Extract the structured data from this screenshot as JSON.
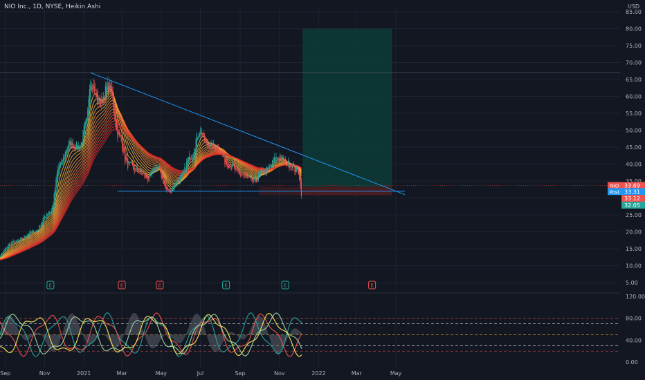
{
  "header": {
    "symbol_title": "NIO Inc., 1D, NYSE, Heikin Ashi",
    "currency": "USD"
  },
  "colors": {
    "background": "#131722",
    "grid": "#1f2330",
    "up": "#26a69a",
    "down": "#ef5350",
    "trendline": "#2196f3",
    "target_zone": "#0d3b36",
    "stop_zone": "#4a1d22",
    "axis_text": "#b2b5be"
  },
  "chart_data": [
    {
      "type": "candlestick",
      "style": "Heikin Ashi",
      "x_labels": [
        "Sep",
        "Nov",
        "2021",
        "Mar",
        "May",
        "Jul",
        "Sep",
        "Nov",
        "2022",
        "Mar",
        "May"
      ],
      "y_ticks": [
        "85.00",
        "80.00",
        "75.00",
        "70.00",
        "65.00",
        "60.00",
        "55.00",
        "50.00",
        "45.00",
        "40.00",
        "35.00",
        "30.00",
        "25.00",
        "20.00",
        "15.00",
        "10.00",
        "5.00"
      ],
      "ylim": [
        3,
        86
      ],
      "approx_close_path": [
        [
          "2020-08-15",
          12
        ],
        [
          "2020-09-15",
          17
        ],
        [
          "2020-10-15",
          20
        ],
        [
          "2020-11-10",
          26
        ],
        [
          "2020-11-25",
          40
        ],
        [
          "2020-12-10",
          46
        ],
        [
          "2020-12-25",
          45
        ],
        [
          "2021-01-05",
          52
        ],
        [
          "2021-01-11",
          65
        ],
        [
          "2021-01-25",
          58
        ],
        [
          "2021-02-09",
          63
        ],
        [
          "2021-02-25",
          48
        ],
        [
          "2021-03-10",
          40
        ],
        [
          "2021-03-25",
          38
        ],
        [
          "2021-04-10",
          36
        ],
        [
          "2021-04-25",
          39
        ],
        [
          "2021-05-12",
          32
        ],
        [
          "2021-06-01",
          36
        ],
        [
          "2021-06-15",
          42
        ],
        [
          "2021-07-01",
          50
        ],
        [
          "2021-07-10",
          46
        ],
        [
          "2021-07-25",
          45
        ],
        [
          "2021-08-15",
          40
        ],
        [
          "2021-09-01",
          37
        ],
        [
          "2021-09-20",
          35
        ],
        [
          "2021-10-10",
          38
        ],
        [
          "2021-10-30",
          42
        ],
        [
          "2021-11-15",
          40
        ],
        [
          "2021-11-30",
          38
        ],
        [
          "2021-12-06",
          31
        ]
      ],
      "trendline": {
        "from": [
          "2021-01-11",
          67
        ],
        "to": [
          "2022-05-15",
          31
        ]
      },
      "support": {
        "from": [
          "2021-02-22",
          32
        ],
        "to": [
          "2022-05-15",
          32
        ]
      },
      "horizontal_level": 67,
      "position": {
        "start": "2021-12-07",
        "end": "2022-04-25",
        "entry": 33.31,
        "target": 80,
        "stop": 30.8
      },
      "price_labels": [
        {
          "label": "NIO",
          "value": "33.69",
          "price": 33.69,
          "color": "#ef5350"
        },
        {
          "label": "Post",
          "value": "33.31",
          "price": 31.9,
          "color": "#2196f3"
        },
        {
          "label": "",
          "value": "33.12",
          "price": 29.9,
          "color": "#ef5350"
        },
        {
          "label": "",
          "value": "32.05",
          "price": 27.9,
          "color": "#26a69a"
        }
      ],
      "earnings_markers": [
        {
          "date": "2020-11-10",
          "label": "E",
          "color": "#26a69a"
        },
        {
          "date": "2021-03-01",
          "label": "E",
          "color": "#ef5350"
        },
        {
          "date": "2021-04-29",
          "label": "E",
          "color": "#ef5350"
        },
        {
          "date": "2021-08-10",
          "label": "E",
          "color": "#26a69a"
        },
        {
          "date": "2021-11-10",
          "label": "E",
          "color": "#26a69a"
        },
        {
          "date": "2022-03-25",
          "label": "E",
          "color": "#ef5350"
        }
      ]
    },
    {
      "type": "line",
      "name": "oscillator",
      "y_ticks": [
        "120.00",
        "80.00",
        "40.00",
        "0.00"
      ],
      "ylim": [
        -10,
        125
      ],
      "levels": [
        80,
        70,
        50,
        30,
        20
      ],
      "series_colors": [
        "#26a69a",
        "#ef5350",
        "#ffee58",
        "#a5d6a7"
      ]
    }
  ]
}
